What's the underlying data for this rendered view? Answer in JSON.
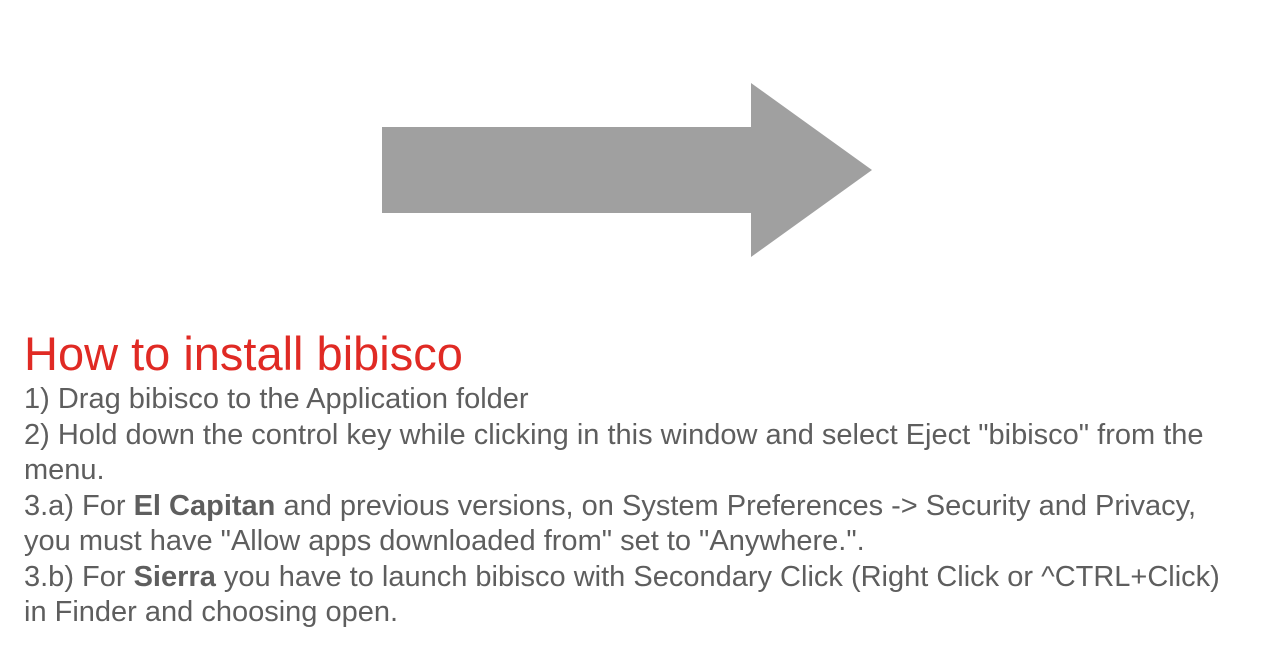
{
  "arrow": {
    "icon": "right-arrow-icon",
    "color": "#a0a0a0"
  },
  "instructions": {
    "title": "How to install bibisco",
    "title_color": "#e02a24",
    "text_color": "#5e5e5e",
    "step1": "1) Drag bibisco to the Application folder",
    "step2": "2) Hold down the control key while clicking in this window and select Eject \"bibisco\" from the menu.",
    "step3a": {
      "prefix": "3.a) For ",
      "bold": "El Capitan",
      "suffix": " and previous versions, on System Preferences -> Security and Privacy, you must have \"Allow apps downloaded from\" set to \"Anywhere.\"."
    },
    "step3b": {
      "prefix": "3.b) For ",
      "bold": "Sierra",
      "suffix": " you have to launch bibisco with Secondary Click (Right Click or ^CTRL+Click) in Finder and choosing open."
    }
  }
}
